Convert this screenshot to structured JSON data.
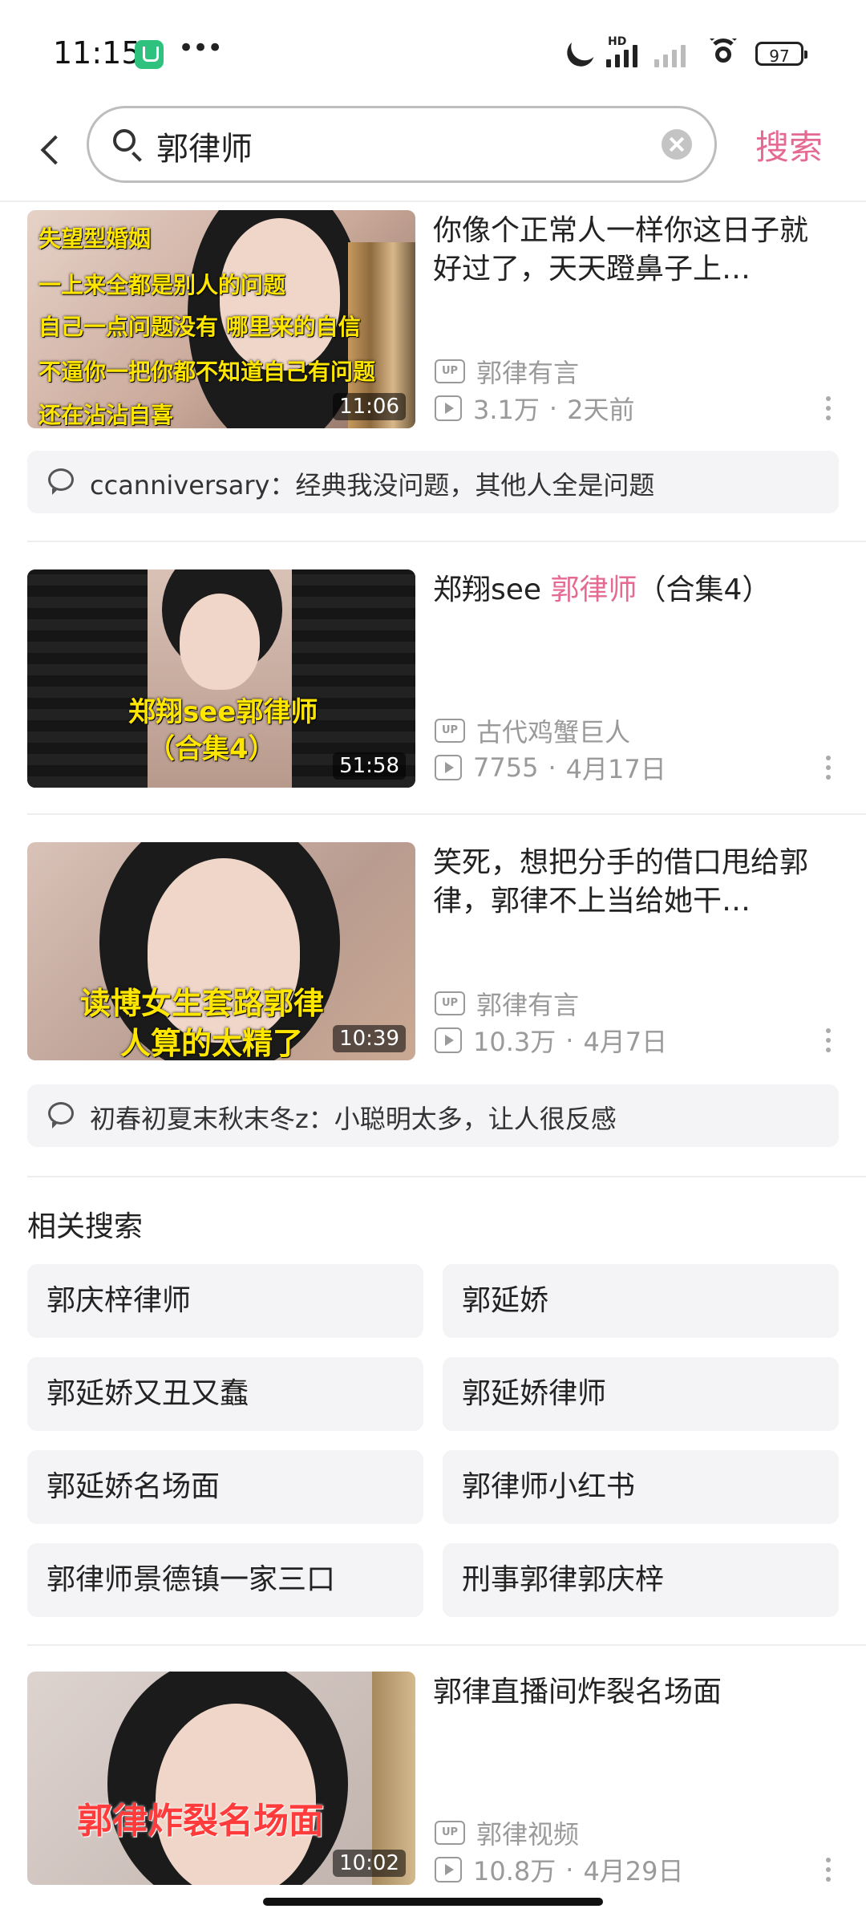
{
  "status_bar": {
    "time": "11:15",
    "hd": "HD",
    "battery": "97"
  },
  "search": {
    "query": "郭律师",
    "button_label": "搜索"
  },
  "videos": [
    {
      "title": "你像个正常人一样你这日子就好过了，天天蹬鼻子上…",
      "uploader": "郭律有言",
      "views": "3.1万",
      "date": "2天前",
      "duration": "11:06",
      "thumb_lines": [
        "失望型婚姻",
        "一上来全都是别人的问题",
        "自己一点问题没有 哪里来的自信",
        "不逼你一把你都不知道自己有问题",
        "还在沾沾自喜"
      ],
      "comment": "ccanniversary：经典我没问题，其他人全是问题"
    },
    {
      "title_prefix": "郑翔see ",
      "title_highlight": "郭律师",
      "title_suffix": "（合集4）",
      "uploader": "古代鸡蟹巨人",
      "views": "7755",
      "date": "4月17日",
      "duration": "51:58",
      "thumb_lines": [
        "郑翔see郭律师",
        "（合集4）"
      ]
    },
    {
      "title": "笑死，想把分手的借口甩给郭律，郭律不上当给她干…",
      "uploader": "郭律有言",
      "views": "10.3万",
      "date": "4月7日",
      "duration": "10:39",
      "thumb_lines": [
        "读博女生套路郭律",
        "人算的太精了"
      ],
      "comment": "初春初夏末秋末冬z：小聪明太多，让人很反感"
    },
    {
      "title": "郭律直播间炸裂名场面",
      "uploader": "郭律视频",
      "views": "10.8万",
      "date": "4月29日",
      "duration": "10:02",
      "thumb_lines": [
        "郭律炸裂名场面"
      ]
    }
  ],
  "related": {
    "title": "相关搜索",
    "items": [
      "郭庆梓律师",
      "郭延娇",
      "郭延娇又丑又蠢",
      "郭延娇律师",
      "郭延娇名场面",
      "郭律师小红书",
      "郭律师景德镇一家三口",
      "刑事郭律郭庆梓"
    ]
  },
  "colors": {
    "accent": "#e46a92",
    "meta": "#9a9a9a",
    "chip_bg": "#f4f4f6"
  },
  "icons": [
    "back-icon",
    "search-icon",
    "clear-icon",
    "up-icon",
    "play-icon",
    "more-icon",
    "comment-icon"
  ]
}
